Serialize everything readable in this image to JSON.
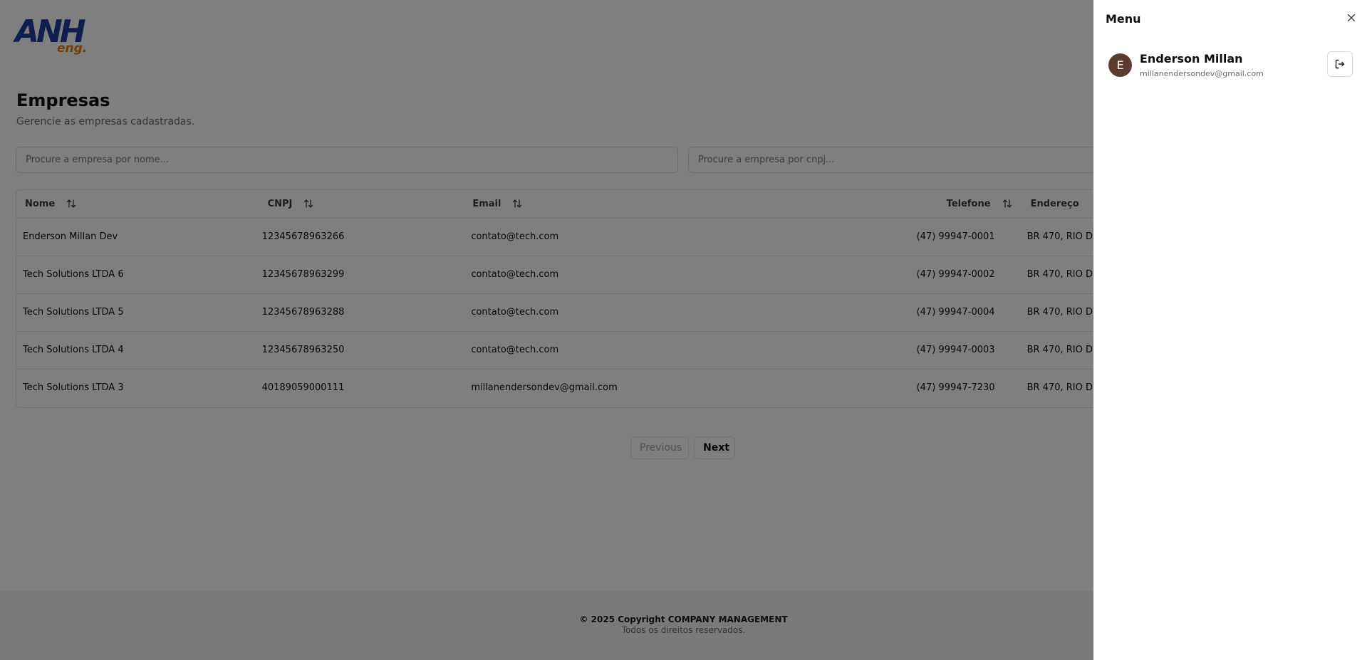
{
  "logo": {
    "main": "ANH",
    "sub": "eng."
  },
  "header": {
    "title": "Empresas",
    "subtitle": "Gerencie as empresas cadastradas."
  },
  "search": {
    "name_placeholder": "Procure a empresa por nome...",
    "cnpj_placeholder": "Procure a empresa por cnpj..."
  },
  "table": {
    "columns": [
      "Nome",
      "CNPJ",
      "Email",
      "Telefone",
      "Endereço"
    ],
    "rows": [
      [
        "Enderson Millan Dev",
        "12345678963266",
        "contato@tech.com",
        "(47) 99947-0001",
        "BR 470, RIO D"
      ],
      [
        "Tech Solutions LTDA 6",
        "12345678963299",
        "contato@tech.com",
        "(47) 99947-0002",
        "BR 470, RIO D"
      ],
      [
        "Tech Solutions LTDA 5",
        "12345678963288",
        "contato@tech.com",
        "(47) 99947-0004",
        "BR 470, RIO D"
      ],
      [
        "Tech Solutions LTDA 4",
        "12345678963250",
        "contato@tech.com",
        "(47) 99947-0003",
        "BR 470, RIO D"
      ],
      [
        "Tech Solutions LTDA 3",
        "40189059000111",
        "millanendersondev@gmail.com",
        "(47) 99947-7230",
        "BR 470, RIO D"
      ]
    ]
  },
  "pagination": {
    "previous": "Previous",
    "next": "Next"
  },
  "footer": {
    "copyright": "© 2025 Copyright COMPANY MANAGEMENT",
    "rights": "Todos os direitos reservados."
  },
  "drawer": {
    "title": "Menu",
    "user": {
      "initial": "E",
      "name": "Enderson Millan",
      "email": "millanendersondev@gmail.com"
    }
  },
  "colors": {
    "brand_blue": "#1f3c9b",
    "brand_orange": "#e07b12",
    "avatar_bg": "#5b3d30",
    "overlay": "rgba(0,0,0,0.5)"
  },
  "icons": [
    "sort-icon",
    "close-icon",
    "logout-icon"
  ]
}
